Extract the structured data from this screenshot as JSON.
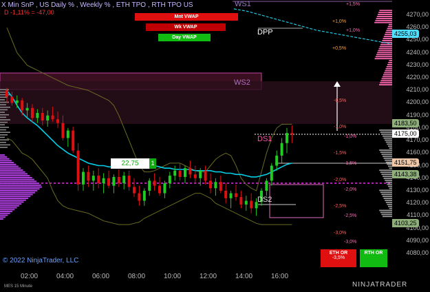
{
  "header": {
    "title": "X Min SnP , US Daily % , Weekly % , ETH TPO , RTH TPO US",
    "subtitle": "D -1,11% = -47,00"
  },
  "buttons": {
    "mnt_vwap": "Mnt VWAP",
    "wk_vwap": "Wk VWAP",
    "day_vwap": "Day VWAP",
    "eth_or": "ETH OR",
    "eth_or_value": "-3,5%",
    "rth_or": "RTH OR"
  },
  "labels": {
    "ws1": "WS1",
    "ws2": "WS2",
    "dpp": "DPP",
    "ds1": "DS1",
    "ds2": "DS2",
    "value_box": "22,75",
    "value_box_count": "1"
  },
  "right_pcts": {
    "p15": "+1,5%",
    "p10": "+1,0%",
    "p10b": "+1,0%",
    "p05": "+0,5%",
    "m05": "-0,5%",
    "m10": "-1,0%",
    "m10b": "-1,0%",
    "m15": "-1,5%",
    "m15b": "-1,5%",
    "m20": "-2,0%",
    "m20b": "-2,0%",
    "m25": "-2,5%",
    "m25b": "-2,5%",
    "m30": "-3,0%",
    "m30b": "-3,0%"
  },
  "y_axis": {
    "ticks": [
      "4270,00",
      "4260,00",
      "4250,00",
      "4240,00",
      "4230,00",
      "4220,00",
      "4210,00",
      "4200,00",
      "4190,00",
      "4180,00",
      "4170,00",
      "4160,00",
      "4150,00",
      "4140,00",
      "4130,00",
      "4120,00",
      "4110,00",
      "4100,00",
      "4090,00",
      "4080,00"
    ],
    "flags": {
      "f4255": "4255,03",
      "f4183": "4183,50",
      "f4175": "4175,00",
      "f4151": "4151,75",
      "f4143": "4143,38",
      "f4103": "4103,25"
    }
  },
  "x_axis": {
    "ticks": [
      "02:00",
      "04:00",
      "06:00",
      "08:00",
      "10:00",
      "12:00",
      "14:00",
      "16:00"
    ]
  },
  "footer": {
    "copyright": "© 2022 NinjaTrader, LLC",
    "series": "MES 15 Minute",
    "brand": "NINJATRADER"
  },
  "colors": {
    "background": "#000000",
    "up_candle": "#22cc22",
    "down_candle": "#dd1111",
    "vwap_line": "#00d0e8",
    "band_line": "#6b6b22",
    "ws_zone": "#3a1020",
    "profile_purple": "#b040e0",
    "profile_pink": "#ff69b4",
    "mnt_vwap": "#e01010",
    "wk_vwap": "#c00000",
    "day_vwap": "#11bb11"
  },
  "chart_data": {
    "type": "candlestick",
    "series_name": "MES 15 Minute",
    "price_scale": [
      4080,
      4275
    ],
    "levels": {
      "ws1": 4273,
      "ws2": 4215,
      "dpp": 4255,
      "ds1": 4175,
      "ds2": 4113,
      "last": 4175.0
    },
    "candles": [
      [
        4210,
        4212,
        4200,
        4205
      ],
      [
        4205,
        4209,
        4198,
        4200
      ],
      [
        4200,
        4206,
        4196,
        4202
      ],
      [
        4202,
        4204,
        4190,
        4194
      ],
      [
        4194,
        4200,
        4188,
        4196
      ],
      [
        4196,
        4199,
        4185,
        4188
      ],
      [
        4188,
        4195,
        4184,
        4192
      ],
      [
        4192,
        4196,
        4182,
        4186
      ],
      [
        4186,
        4194,
        4181,
        4190
      ],
      [
        4190,
        4197,
        4185,
        4187
      ],
      [
        4187,
        4193,
        4180,
        4184
      ],
      [
        4184,
        4190,
        4170,
        4172
      ],
      [
        4172,
        4180,
        4165,
        4178
      ],
      [
        4178,
        4181,
        4160,
        4162
      ],
      [
        4162,
        4168,
        4130,
        4135
      ],
      [
        4135,
        4148,
        4130,
        4145
      ],
      [
        4145,
        4150,
        4133,
        4138
      ],
      [
        4138,
        4146,
        4130,
        4142
      ],
      [
        4142,
        4148,
        4132,
        4136
      ],
      [
        4136,
        4144,
        4128,
        4140
      ],
      [
        4140,
        4146,
        4132,
        4134
      ],
      [
        4134,
        4143,
        4128,
        4141
      ],
      [
        4141,
        4147,
        4133,
        4136
      ],
      [
        4136,
        4145,
        4131,
        4142
      ],
      [
        4142,
        4146,
        4130,
        4133
      ],
      [
        4133,
        4140,
        4125,
        4128
      ],
      [
        4128,
        4134,
        4118,
        4122
      ],
      [
        4122,
        4132,
        4118,
        4130
      ],
      [
        4130,
        4140,
        4126,
        4138
      ],
      [
        4138,
        4144,
        4130,
        4134
      ],
      [
        4134,
        4141,
        4126,
        4128
      ],
      [
        4128,
        4138,
        4124,
        4136
      ],
      [
        4136,
        4145,
        4132,
        4142
      ],
      [
        4142,
        4150,
        4138,
        4146
      ],
      [
        4146,
        4152,
        4138,
        4141
      ],
      [
        4141,
        4150,
        4136,
        4148
      ],
      [
        4148,
        4154,
        4140,
        4143
      ],
      [
        4143,
        4150,
        4136,
        4140
      ],
      [
        4140,
        4148,
        4134,
        4146
      ],
      [
        4146,
        4150,
        4135,
        4138
      ],
      [
        4138,
        4144,
        4128,
        4132
      ],
      [
        4132,
        4140,
        4126,
        4137
      ],
      [
        4137,
        4142,
        4128,
        4130
      ],
      [
        4130,
        4136,
        4120,
        4124
      ],
      [
        4124,
        4130,
        4116,
        4128
      ],
      [
        4128,
        4135,
        4122,
        4125
      ],
      [
        4125,
        4130,
        4116,
        4119
      ],
      [
        4119,
        4126,
        4114,
        4122
      ],
      [
        4122,
        4128,
        4112,
        4116
      ],
      [
        4116,
        4124,
        4110,
        4121
      ],
      [
        4121,
        4132,
        4118,
        4130
      ],
      [
        4130,
        4140,
        4126,
        4138
      ],
      [
        4138,
        4152,
        4134,
        4150
      ],
      [
        4150,
        4162,
        4146,
        4158
      ],
      [
        4158,
        4172,
        4152,
        4168
      ],
      [
        4168,
        4180,
        4160,
        4176
      ],
      [
        4176,
        4182,
        4168,
        4175
      ]
    ]
  }
}
